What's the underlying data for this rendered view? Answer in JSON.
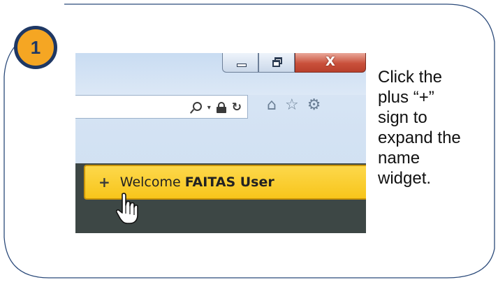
{
  "step": {
    "number": "1"
  },
  "browser": {
    "window_controls": {
      "minimize_icon": "minimize-icon",
      "restore_icon": "restore-icon",
      "close_label": "X"
    },
    "address_bar": {
      "icons": [
        "search-icon",
        "dropdown-icon",
        "lock-icon",
        "refresh-icon"
      ],
      "dropdown_glyph": "▾",
      "refresh_glyph": "↻"
    },
    "toolbar_icons": [
      {
        "name": "home-icon",
        "glyph": "⌂"
      },
      {
        "name": "star-icon",
        "glyph": "☆"
      },
      {
        "name": "gear-icon",
        "glyph": "⚙"
      }
    ]
  },
  "welcome_widget": {
    "plus": "+",
    "welcome": "Welcome",
    "user": "FAITAS User"
  },
  "instruction": {
    "text": "Click the\nplus “+”\nsign to\nexpand the\nname\nwidget."
  },
  "colors": {
    "badge_fill": "#f5a623",
    "badge_border": "#1f3864",
    "widget_yellow": "#fdd84b",
    "card_border": "#1f3864",
    "nav_strip": "#3d4745"
  }
}
